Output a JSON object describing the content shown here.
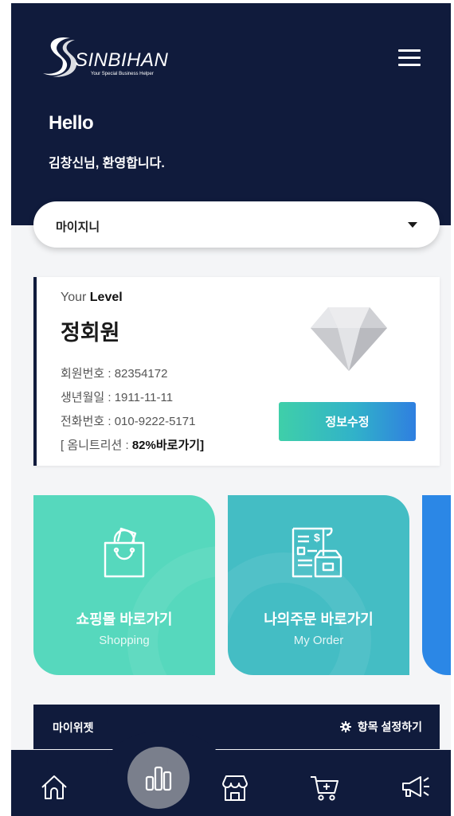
{
  "header": {
    "brand": "SINBIHAN",
    "tagline": "Your Special Business Helper",
    "greeting": "Hello",
    "welcome": "김창신님, 환영합니다."
  },
  "selector": {
    "value": "마이지니"
  },
  "level_card": {
    "your": "Your",
    "level": "Level",
    "grade": "정회원",
    "member_no_label": "회원번호 : ",
    "member_no": "82354172",
    "birth_label": "생년월일 : ",
    "birth": "1911-11-11",
    "phone_label": "전화번호 : ",
    "phone": "010-9222-5171",
    "omni_prefix": "[ 옴니트리션 : ",
    "omni_link": "82%바로가기]",
    "edit_button": "정보수정"
  },
  "tiles": [
    {
      "title": "쇼핑몰 바로가기",
      "subtitle": "Shopping",
      "icon": "shopping-bag-icon",
      "color": "#56d8bd"
    },
    {
      "title": "나의주문 바로가기",
      "subtitle": "My Order",
      "icon": "order-receipt-icon",
      "color": "#44bdc4"
    },
    {
      "title": "",
      "subtitle": "",
      "icon": "",
      "color": "#2b87e6"
    }
  ],
  "widget": {
    "title": "마이위젯",
    "settings": "항목 설정하기"
  },
  "tabbar": {
    "items": [
      "home-icon",
      "chart-icon",
      "store-icon",
      "cart-icon",
      "megaphone-icon"
    ]
  },
  "colors": {
    "navy": "#101b3c",
    "mint": "#56d8bd",
    "teal": "#44bdc4",
    "blue": "#2b87e6"
  }
}
